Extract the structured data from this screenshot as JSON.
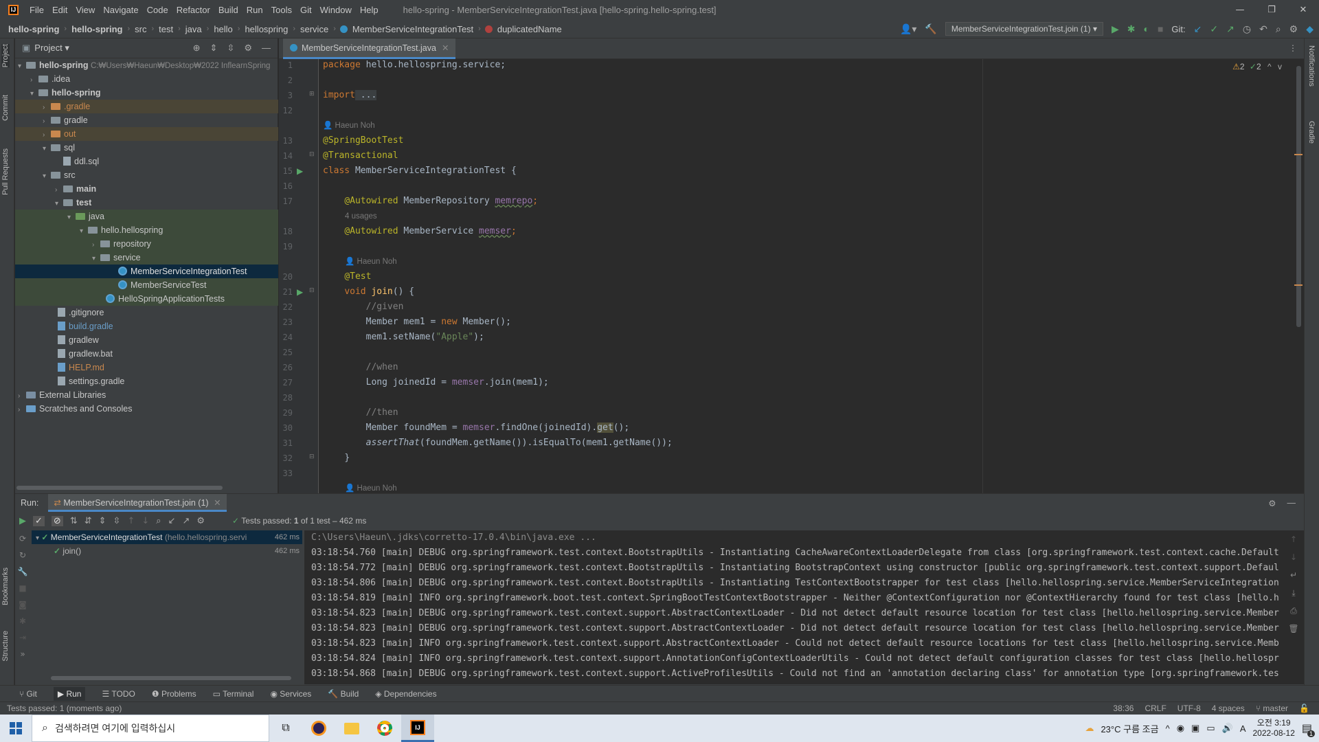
{
  "menubar": {
    "items": [
      "File",
      "Edit",
      "View",
      "Navigate",
      "Code",
      "Refactor",
      "Build",
      "Run",
      "Tools",
      "Git",
      "Window",
      "Help"
    ],
    "title": "hello-spring - MemberServiceIntegrationTest.java [hello-spring.hello-spring.test]",
    "minimize": "—",
    "restore": "❐",
    "close": "✕"
  },
  "breadcrumbs": [
    "hello-spring",
    "hello-spring",
    "src",
    "test",
    "java",
    "hello",
    "hellospring",
    "service",
    "MemberServiceIntegrationTest",
    "duplicatedName"
  ],
  "toolbar": {
    "run_config": "MemberServiceIntegrationTest.join (1)",
    "git_label": "Git:"
  },
  "left_stripe": {
    "project": "Project",
    "commit": "Commit",
    "pull_requests": "Pull Requests",
    "bookmarks": "Bookmarks",
    "structure": "Structure"
  },
  "right_stripe": {
    "notifications": "Notifications",
    "gradle": "Gradle"
  },
  "project": {
    "header": "Project",
    "tree": [
      {
        "label": "hello-spring",
        "extra": "C:₩Users₩Haeun₩Desktop₩2022 InflearnSpring",
        "icon": "folder-icon"
      },
      {
        "label": ".idea",
        "icon": "folder-icon"
      },
      {
        "label": "hello-spring",
        "icon": "folder-icon"
      },
      {
        "label": ".gradle",
        "icon": "folder-icon"
      },
      {
        "label": "gradle",
        "icon": "folder-icon"
      },
      {
        "label": "out",
        "icon": "folder-icon"
      },
      {
        "label": "sql",
        "icon": "folder-icon"
      },
      {
        "label": "ddl.sql",
        "icon": "file-icon"
      },
      {
        "label": "src",
        "icon": "folder-icon"
      },
      {
        "label": "main",
        "icon": "folder-icon"
      },
      {
        "label": "test",
        "icon": "folder-icon"
      },
      {
        "label": "java",
        "icon": "folder-icon"
      },
      {
        "label": "hello.hellospring",
        "icon": "folder-icon"
      },
      {
        "label": "repository",
        "icon": "folder-icon"
      },
      {
        "label": "service",
        "icon": "folder-icon"
      },
      {
        "label": "MemberServiceIntegrationTest",
        "icon": "class-icon"
      },
      {
        "label": "MemberServiceTest",
        "icon": "class-icon"
      },
      {
        "label": "HelloSpringApplicationTests",
        "icon": "class-icon"
      },
      {
        "label": ".gitignore",
        "icon": "file-icon"
      },
      {
        "label": "build.gradle",
        "icon": "file-icon"
      },
      {
        "label": "gradlew",
        "icon": "file-icon"
      },
      {
        "label": "gradlew.bat",
        "icon": "file-icon"
      },
      {
        "label": "HELP.md",
        "icon": "file-icon"
      },
      {
        "label": "settings.gradle",
        "icon": "file-icon"
      },
      {
        "label": "External Libraries",
        "icon": "library-icon"
      },
      {
        "label": "Scratches and Consoles",
        "icon": "scratch-icon"
      }
    ]
  },
  "editor": {
    "tab": "MemberServiceIntegrationTest.java",
    "inspections": {
      "warnings": "2",
      "ok": "2"
    },
    "line_numbers": [
      "1",
      "2",
      "3",
      "12",
      "",
      "13",
      "14",
      "15",
      "16",
      "17",
      "",
      "18",
      "19",
      "",
      "20",
      "21",
      "22",
      "23",
      "24",
      "25",
      "26",
      "27",
      "28",
      "29",
      "30",
      "31",
      "32",
      "33",
      ""
    ],
    "hints": {
      "author": "Haeun Noh",
      "usages": "4 usages"
    },
    "code": {
      "l1_kw": "package",
      "l1_rest": " hello.hellospring.service;",
      "l3_kw": "import",
      "l3_rest": " ...",
      "l13": "@SpringBootTest",
      "l14": "@Transactional",
      "l15_kw": "class",
      "l15_rest": " MemberServiceIntegrationTest {",
      "l17_an": "@Autowired",
      "l17_type": " MemberRepository ",
      "l17_fld": "memrepo",
      "l17_end": ";",
      "l18_an": "@Autowired",
      "l18_type": " MemberService ",
      "l18_fld": "memser",
      "l18_end": ";",
      "l20": "@Test",
      "l21_kw": "void",
      "l21_fn": "join",
      "l21_rest": "() {",
      "l22": "//given",
      "l23_a": "Member mem1 = ",
      "l23_kw": "new",
      "l23_b": " Member();",
      "l24_a": "mem1.setName(",
      "l24_str": "\"Apple\"",
      "l24_b": ");",
      "l26": "//when",
      "l27_a": "Long joinedId = ",
      "l27_fld": "memser",
      "l27_b": ".join(mem1);",
      "l29": "//then",
      "l30_a": "Member foundMem = ",
      "l30_fld": "memser",
      "l30_b": ".findOne(joinedId).",
      "l30_get": "get",
      "l30_c": "();",
      "l31_it": "assertThat",
      "l31_b": "(foundMem.getName()).isEqualTo(mem1.getName());",
      "l32": "}"
    }
  },
  "run": {
    "label": "Run:",
    "tab": "MemberServiceIntegrationTest.join (1)",
    "status_prefix": "Tests passed: ",
    "status_count": "1",
    "status_suffix": " of 1 test – 462 ms",
    "tree": [
      {
        "label": "MemberServiceIntegrationTest",
        "pkg": "(hello.hellospring.servi",
        "time": "462 ms"
      },
      {
        "label": "join()",
        "time": "462 ms"
      }
    ],
    "console": [
      "C:\\Users\\Haeun\\.jdks\\corretto-17.0.4\\bin\\java.exe ...",
      "03:18:54.760 [main] DEBUG org.springframework.test.context.BootstrapUtils - Instantiating CacheAwareContextLoaderDelegate from class [org.springframework.test.context.cache.Default",
      "03:18:54.772 [main] DEBUG org.springframework.test.context.BootstrapUtils - Instantiating BootstrapContext using constructor [public org.springframework.test.context.support.Defaul",
      "03:18:54.806 [main] DEBUG org.springframework.test.context.BootstrapUtils - Instantiating TestContextBootstrapper for test class [hello.hellospring.service.MemberServiceIntegration",
      "03:18:54.819 [main] INFO org.springframework.boot.test.context.SpringBootTestContextBootstrapper - Neither @ContextConfiguration nor @ContextHierarchy found for test class [hello.h",
      "03:18:54.823 [main] DEBUG org.springframework.test.context.support.AbstractContextLoader - Did not detect default resource location for test class [hello.hellospring.service.Member",
      "03:18:54.823 [main] DEBUG org.springframework.test.context.support.AbstractContextLoader - Did not detect default resource location for test class [hello.hellospring.service.Member",
      "03:18:54.823 [main] INFO org.springframework.test.context.support.AbstractContextLoader - Could not detect default resource locations for test class [hello.hellospring.service.Memb",
      "03:18:54.824 [main] INFO org.springframework.test.context.support.AnnotationConfigContextLoaderUtils - Could not detect default configuration classes for test class [hello.hellospr",
      "03:18:54.868 [main] DEBUG org.springframework.test.context.support.ActiveProfilesUtils - Could not find an 'annotation declaring class' for annotation type [org.springframework.tes"
    ]
  },
  "tooltabs": [
    "Git",
    "Run",
    "TODO",
    "Problems",
    "Terminal",
    "Services",
    "Build",
    "Dependencies"
  ],
  "statusbar": {
    "message": "Tests passed: 1 (moments ago)",
    "position": "38:36",
    "line_sep": "CRLF",
    "encoding": "UTF-8",
    "indent": "4 spaces",
    "branch": "master"
  },
  "taskbar": {
    "search_placeholder": "검색하려면 여기에 입력하십시",
    "weather": "23°C 구름 조금",
    "ime": "A",
    "time": "오전 3:19",
    "date": "2022-08-12",
    "notif_count": "1"
  },
  "colors": {
    "accent": "#4a88c7",
    "selection": "#0d293e",
    "test_bg": "#3d4a3a",
    "pass": "#59a869"
  }
}
